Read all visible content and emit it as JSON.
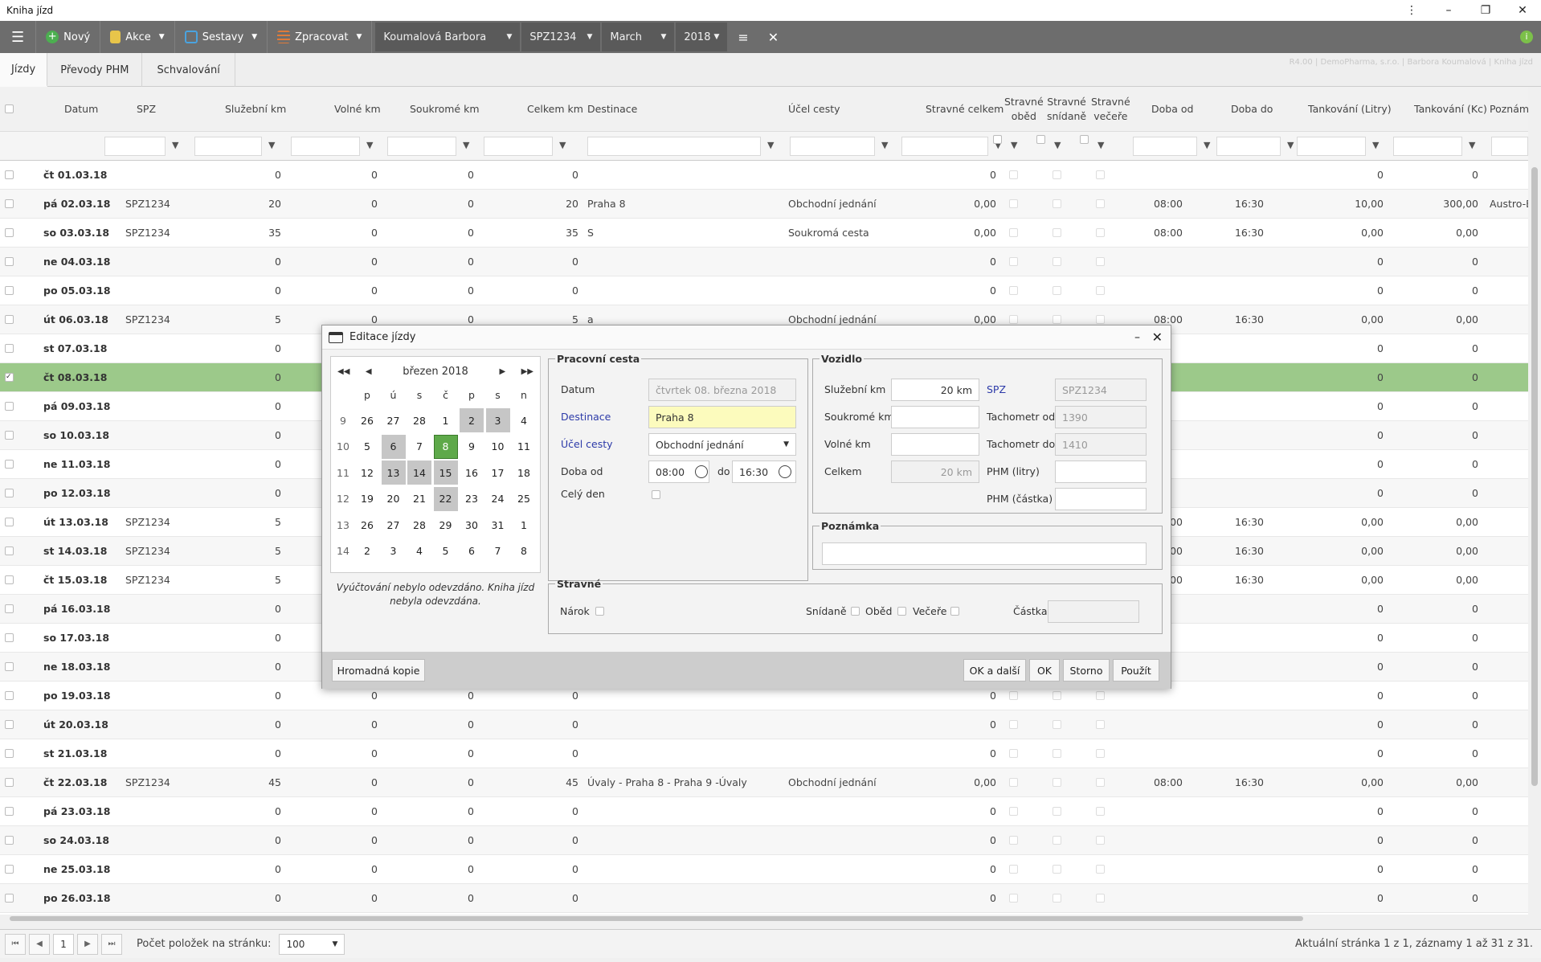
{
  "app": {
    "title": "Kniha jízd"
  },
  "toolbar": {
    "novy": "Nový",
    "akce": "Akce",
    "sestavy": "Sestavy",
    "zpracovat": "Zpracovat",
    "person": "Koumalová Barbora",
    "spz": "SPZ1234",
    "month": "March",
    "year": "2018"
  },
  "tabs": [
    "Jízdy",
    "Převody PHM",
    "Schvalování"
  ],
  "tab_info": "R4.00 | DemoPharma, s.r.o. | Barbora Koumalová | Kniha jízd",
  "grid": {
    "headers": {
      "datum": "Datum",
      "spz": "SPZ",
      "sluzebni": "Služební km",
      "volne": "Volné km",
      "soukrome": "Soukromé km",
      "celkem": "Celkem km",
      "destinace": "Destinace",
      "ucel": "Účel cesty",
      "stravne_celkem": "Stravné celkem",
      "stravne_obed": "Stravné oběd",
      "stravne_snidane": "Stravné snídaně",
      "stravne_vecere": "Stravné večeře",
      "doba_od": "Doba od",
      "doba_do": "Doba do",
      "tank_l": "Tankování (Litry)",
      "tank_k": "Tankování (Kc)",
      "poznamka": "Poznám"
    },
    "rows": [
      {
        "d": "čt 01.03.18",
        "spz": "",
        "s": "0",
        "v": "0",
        "so": "0",
        "c": "0",
        "dest": "",
        "u": "",
        "sc": "0",
        "od": "",
        "do": "",
        "tl": "0",
        "tk": "0",
        "p": ""
      },
      {
        "d": "pá 02.03.18",
        "spz": "SPZ1234",
        "s": "20",
        "v": "0",
        "so": "0",
        "c": "20",
        "dest": "Praha 8",
        "u": "Obchodní jednání",
        "sc": "0,00",
        "od": "08:00",
        "do": "16:30",
        "tl": "10,00",
        "tk": "300,00",
        "p": "Austro-E"
      },
      {
        "d": "so 03.03.18",
        "spz": "SPZ1234",
        "s": "35",
        "v": "0",
        "so": "0",
        "c": "35",
        "dest": "S",
        "u": "Soukromá cesta",
        "sc": "0,00",
        "od": "08:00",
        "do": "16:30",
        "tl": "0,00",
        "tk": "0,00",
        "p": ""
      },
      {
        "d": "ne 04.03.18",
        "spz": "",
        "s": "0",
        "v": "0",
        "so": "0",
        "c": "0",
        "dest": "",
        "u": "",
        "sc": "0",
        "od": "",
        "do": "",
        "tl": "0",
        "tk": "0",
        "p": ""
      },
      {
        "d": "po 05.03.18",
        "spz": "",
        "s": "0",
        "v": "0",
        "so": "0",
        "c": "0",
        "dest": "",
        "u": "",
        "sc": "0",
        "od": "",
        "do": "",
        "tl": "0",
        "tk": "0",
        "p": ""
      },
      {
        "d": "út 06.03.18",
        "spz": "SPZ1234",
        "s": "5",
        "v": "0",
        "so": "0",
        "c": "5",
        "dest": "a",
        "u": "Obchodní jednání",
        "sc": "0,00",
        "od": "08:00",
        "do": "16:30",
        "tl": "0,00",
        "tk": "0,00",
        "p": ""
      },
      {
        "d": "st 07.03.18",
        "spz": "",
        "s": "0",
        "v": "",
        "so": "",
        "c": "",
        "dest": "",
        "u": "",
        "sc": "",
        "od": "",
        "do": "",
        "tl": "0",
        "tk": "0",
        "p": ""
      },
      {
        "d": "čt 08.03.18",
        "spz": "",
        "s": "0",
        "v": "",
        "so": "",
        "c": "",
        "dest": "",
        "u": "",
        "sc": "",
        "od": "",
        "do": "",
        "tl": "0",
        "tk": "0",
        "p": ""
      },
      {
        "d": "pá 09.03.18",
        "spz": "",
        "s": "0",
        "v": "",
        "so": "",
        "c": "",
        "dest": "",
        "u": "",
        "sc": "",
        "od": "",
        "do": "",
        "tl": "0",
        "tk": "0",
        "p": ""
      },
      {
        "d": "so 10.03.18",
        "spz": "",
        "s": "0",
        "v": "",
        "so": "",
        "c": "",
        "dest": "",
        "u": "",
        "sc": "",
        "od": "",
        "do": "",
        "tl": "0",
        "tk": "0",
        "p": ""
      },
      {
        "d": "ne 11.03.18",
        "spz": "",
        "s": "0",
        "v": "",
        "so": "",
        "c": "",
        "dest": "",
        "u": "",
        "sc": "",
        "od": "",
        "do": "",
        "tl": "0",
        "tk": "0",
        "p": ""
      },
      {
        "d": "po 12.03.18",
        "spz": "",
        "s": "0",
        "v": "",
        "so": "",
        "c": "",
        "dest": "",
        "u": "",
        "sc": "",
        "od": "",
        "do": "",
        "tl": "0",
        "tk": "0",
        "p": ""
      },
      {
        "d": "út 13.03.18",
        "spz": "SPZ1234",
        "s": "5",
        "v": "",
        "so": "",
        "c": "",
        "dest": "",
        "u": "",
        "sc": "",
        "od": "00",
        "do": "16:30",
        "tl": "0,00",
        "tk": "0,00",
        "p": ""
      },
      {
        "d": "st 14.03.18",
        "spz": "SPZ1234",
        "s": "5",
        "v": "",
        "so": "",
        "c": "",
        "dest": "",
        "u": "",
        "sc": "",
        "od": "00",
        "do": "16:30",
        "tl": "0,00",
        "tk": "0,00",
        "p": ""
      },
      {
        "d": "čt 15.03.18",
        "spz": "SPZ1234",
        "s": "5",
        "v": "",
        "so": "",
        "c": "",
        "dest": "",
        "u": "",
        "sc": "",
        "od": "00",
        "do": "16:30",
        "tl": "0,00",
        "tk": "0,00",
        "p": ""
      },
      {
        "d": "pá 16.03.18",
        "spz": "",
        "s": "0",
        "v": "",
        "so": "",
        "c": "",
        "dest": "",
        "u": "",
        "sc": "",
        "od": "",
        "do": "",
        "tl": "0",
        "tk": "0",
        "p": ""
      },
      {
        "d": "so 17.03.18",
        "spz": "",
        "s": "0",
        "v": "",
        "so": "",
        "c": "",
        "dest": "",
        "u": "",
        "sc": "",
        "od": "",
        "do": "",
        "tl": "0",
        "tk": "0",
        "p": ""
      },
      {
        "d": "ne 18.03.18",
        "spz": "",
        "s": "0",
        "v": "",
        "so": "",
        "c": "",
        "dest": "",
        "u": "",
        "sc": "",
        "od": "",
        "do": "",
        "tl": "0",
        "tk": "0",
        "p": ""
      },
      {
        "d": "po 19.03.18",
        "spz": "",
        "s": "0",
        "v": "0",
        "so": "0",
        "c": "0",
        "dest": "",
        "u": "",
        "sc": "0",
        "od": "",
        "do": "",
        "tl": "0",
        "tk": "0",
        "p": ""
      },
      {
        "d": "út 20.03.18",
        "spz": "",
        "s": "0",
        "v": "0",
        "so": "0",
        "c": "0",
        "dest": "",
        "u": "",
        "sc": "0",
        "od": "",
        "do": "",
        "tl": "0",
        "tk": "0",
        "p": ""
      },
      {
        "d": "st 21.03.18",
        "spz": "",
        "s": "0",
        "v": "0",
        "so": "0",
        "c": "0",
        "dest": "",
        "u": "",
        "sc": "0",
        "od": "",
        "do": "",
        "tl": "0",
        "tk": "0",
        "p": ""
      },
      {
        "d": "čt 22.03.18",
        "spz": "SPZ1234",
        "s": "45",
        "v": "0",
        "so": "0",
        "c": "45",
        "dest": "Úvaly - Praha 8 - Praha 9 -Úvaly",
        "u": "Obchodní jednání",
        "sc": "0,00",
        "od": "08:00",
        "do": "16:30",
        "tl": "0,00",
        "tk": "0,00",
        "p": ""
      },
      {
        "d": "pá 23.03.18",
        "spz": "",
        "s": "0",
        "v": "0",
        "so": "0",
        "c": "0",
        "dest": "",
        "u": "",
        "sc": "0",
        "od": "",
        "do": "",
        "tl": "0",
        "tk": "0",
        "p": ""
      },
      {
        "d": "so 24.03.18",
        "spz": "",
        "s": "0",
        "v": "0",
        "so": "0",
        "c": "0",
        "dest": "",
        "u": "",
        "sc": "0",
        "od": "",
        "do": "",
        "tl": "0",
        "tk": "0",
        "p": ""
      },
      {
        "d": "ne 25.03.18",
        "spz": "",
        "s": "0",
        "v": "0",
        "so": "0",
        "c": "0",
        "dest": "",
        "u": "",
        "sc": "0",
        "od": "",
        "do": "",
        "tl": "0",
        "tk": "0",
        "p": ""
      },
      {
        "d": "po 26.03.18",
        "spz": "",
        "s": "0",
        "v": "0",
        "so": "0",
        "c": "0",
        "dest": "",
        "u": "",
        "sc": "0",
        "od": "",
        "do": "",
        "tl": "0",
        "tk": "0",
        "p": ""
      }
    ]
  },
  "pager": {
    "page": "1",
    "per_page_label": "Počet položek na stránku:",
    "per_page": "100",
    "info": "Aktuální stránka 1 z 1, záznamy 1 až 31 z 31."
  },
  "dialog": {
    "title": "Editace jízdy",
    "calendar": {
      "month": "březen 2018",
      "weekdays": [
        "p",
        "ú",
        "s",
        "č",
        "p",
        "s",
        "n"
      ],
      "weeks": [
        [
          "9",
          "26",
          "27",
          "28",
          "1",
          "2",
          "3",
          "4"
        ],
        [
          "10",
          "5",
          "6",
          "7",
          "8",
          "9",
          "10",
          "11"
        ],
        [
          "11",
          "12",
          "13",
          "14",
          "15",
          "16",
          "17",
          "18"
        ],
        [
          "12",
          "19",
          "20",
          "21",
          "22",
          "23",
          "24",
          "25"
        ],
        [
          "13",
          "26",
          "27",
          "28",
          "29",
          "30",
          "31",
          "1"
        ],
        [
          "14",
          "2",
          "3",
          "4",
          "5",
          "6",
          "7",
          "8"
        ]
      ],
      "note": "Vyúčtování nebylo odevzdáno. Kniha jízd nebyla odevzdána."
    },
    "pracovni": {
      "legend": "Pracovní cesta",
      "datum_label": "Datum",
      "datum": "čtvrtek 08. března 2018",
      "dest_label": "Destinace",
      "dest": "Praha 8",
      "ucel_label": "Účel cesty",
      "ucel": "Obchodní jednání",
      "doba_label": "Doba od",
      "od": "08:00",
      "do_label": "do",
      "do": "16:30",
      "cely_label": "Celý den"
    },
    "vozidlo": {
      "legend": "Vozidlo",
      "sluzebni_label": "Služební km",
      "sluzebni": "20 km",
      "soukrome_label": "Soukromé km",
      "volne_label": "Volné km",
      "celkem_label": "Celkem",
      "celkem": "20 km",
      "spz_label": "SPZ",
      "spz": "SPZ1234",
      "tod_label": "Tachometr od",
      "tod": "1390",
      "tdo_label": "Tachometr do",
      "tdo": "1410",
      "phm_l_label": "PHM (litry)",
      "phm_k_label": "PHM (částka)"
    },
    "poznamka": {
      "legend": "Poznámka"
    },
    "stravne": {
      "legend": "Stravné",
      "narok": "Nárok",
      "snidane": "Snídaně",
      "obed": "Oběd",
      "vecere": "Večeře",
      "castka": "Částka"
    },
    "buttons": {
      "kopie": "Hromadná kopie",
      "okdalsi": "OK a další",
      "ok": "OK",
      "storno": "Storno",
      "pouzit": "Použít"
    }
  },
  "colors": {
    "toolbar": "#6d6d6d",
    "selected_row": "#9cc98a",
    "calendar_today": "#5ea94a",
    "highlight_input": "#fcfbbd",
    "link_label": "#2c3aa8"
  }
}
